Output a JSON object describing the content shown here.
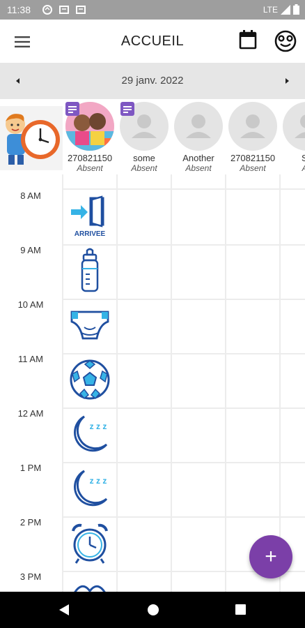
{
  "status_bar": {
    "time": "11:38",
    "network": "LTE"
  },
  "app_bar": {
    "title": "ACCUEIL",
    "icons": [
      "menu-icon",
      "calendar-icon",
      "smiley-face-icon"
    ]
  },
  "date_bar": {
    "date": "29 janv. 2022"
  },
  "children": [
    {
      "name": "270821150",
      "status": "Absent",
      "has_note": true,
      "photo": true
    },
    {
      "name": "some",
      "status": "Absent",
      "has_note": true,
      "photo": false
    },
    {
      "name": "Another",
      "status": "Absent",
      "has_note": false,
      "photo": false
    },
    {
      "name": "270821150",
      "status": "Absent",
      "has_note": false,
      "photo": false
    },
    {
      "name": "Sa",
      "status": "Ab",
      "has_note": false,
      "photo": false
    }
  ],
  "hours": [
    "8 AM",
    "9 AM",
    "10 AM",
    "11 AM",
    "12 AM",
    "1 PM",
    "2 PM",
    "3 PM"
  ],
  "activities": [
    {
      "icon": "arrival-door-icon",
      "label": "ARRIVEE"
    },
    {
      "icon": "baby-bottle-icon"
    },
    {
      "icon": "diaper-icon"
    },
    {
      "icon": "soccer-ball-icon"
    },
    {
      "icon": "moon-sleep-icon",
      "label": "z z z"
    },
    {
      "icon": "moon-sleep-icon",
      "label": "z z z"
    },
    {
      "icon": "alarm-clock-icon"
    },
    {
      "icon": "partial-icon"
    }
  ],
  "colors": {
    "accent": "#7b3fa8",
    "icon_blue": "#1f4fa0",
    "icon_cyan": "#36b3e6"
  },
  "fab": {
    "label": "+"
  }
}
